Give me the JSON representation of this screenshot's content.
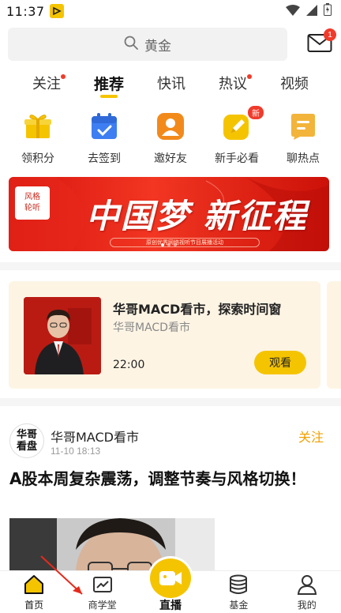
{
  "status_bar": {
    "time": "11:37"
  },
  "search": {
    "placeholder": "黄金"
  },
  "mail": {
    "badge_count": "1"
  },
  "tabs": [
    {
      "label": "关注",
      "dot": true
    },
    {
      "label": "推荐",
      "active": true
    },
    {
      "label": "快讯"
    },
    {
      "label": "热议",
      "dot": true
    },
    {
      "label": "视频"
    }
  ],
  "quick_actions": [
    {
      "label": "领积分",
      "icon": "gift-icon"
    },
    {
      "label": "去签到",
      "icon": "calendar-icon"
    },
    {
      "label": "邀好友",
      "icon": "person-icon"
    },
    {
      "label": "新手必看",
      "icon": "pen-icon",
      "badge": "新"
    },
    {
      "label": "聊热点",
      "icon": "chat-icon"
    }
  ],
  "banner": {
    "logo_line1": "风格",
    "logo_line2": "轮听",
    "title": "中国梦 新征程",
    "subtitle": "原创优秀网络视听节目展播活动"
  },
  "live_card": {
    "title": "华哥MACD看市，探索时间窗",
    "author": "华哥MACD看市",
    "time": "22:00",
    "button": "观看"
  },
  "post": {
    "avatar_line1": "华哥",
    "avatar_line2": "看盘",
    "author": "华哥MACD看市",
    "timestamp": "11-10 18:13",
    "follow": "关注",
    "title": "A股本周复杂震荡，调整节奏与风格切换！"
  },
  "bottom_nav": {
    "home": "首页",
    "school": "商学堂",
    "live": "直播",
    "fund": "基金",
    "mine": "我的"
  },
  "colors": {
    "accent": "#f5c400",
    "badge": "#f03b2b",
    "follow": "#f0a000"
  }
}
